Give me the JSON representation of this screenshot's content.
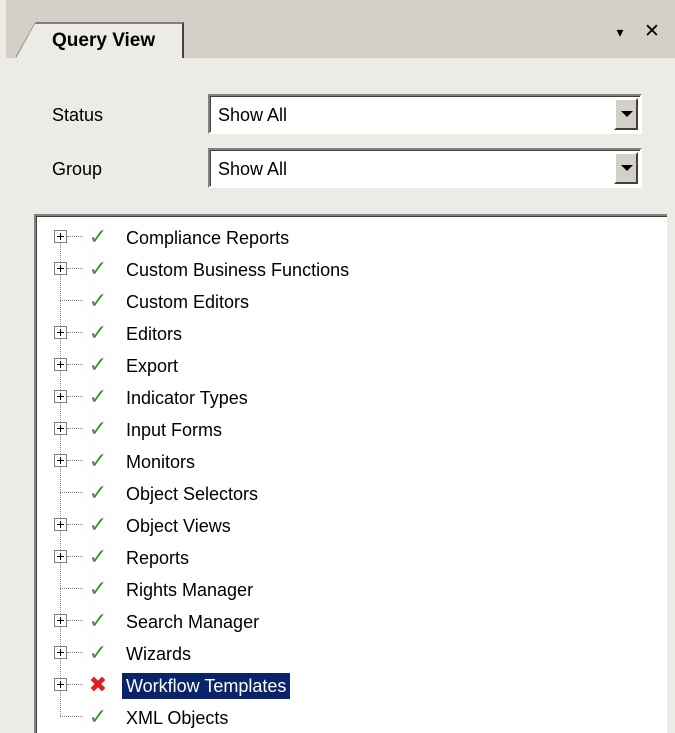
{
  "tab": {
    "title": "Query View"
  },
  "pane_buttons": {
    "dropdown": "▾",
    "close": "✕"
  },
  "filters": {
    "status": {
      "label": "Status",
      "value": "Show All"
    },
    "group": {
      "label": "Group",
      "value": "Show All"
    }
  },
  "tree": {
    "items": [
      {
        "label": "Compliance Reports",
        "expandable": true,
        "status": "ok"
      },
      {
        "label": "Custom Business Functions",
        "expandable": true,
        "status": "ok"
      },
      {
        "label": "Custom Editors",
        "expandable": false,
        "status": "ok"
      },
      {
        "label": "Editors",
        "expandable": true,
        "status": "ok"
      },
      {
        "label": "Export",
        "expandable": true,
        "status": "ok"
      },
      {
        "label": "Indicator Types",
        "expandable": true,
        "status": "ok"
      },
      {
        "label": "Input Forms",
        "expandable": true,
        "status": "ok"
      },
      {
        "label": "Monitors",
        "expandable": true,
        "status": "ok"
      },
      {
        "label": "Object Selectors",
        "expandable": false,
        "status": "ok"
      },
      {
        "label": "Object Views",
        "expandable": true,
        "status": "ok"
      },
      {
        "label": "Reports",
        "expandable": true,
        "status": "ok"
      },
      {
        "label": "Rights Manager",
        "expandable": false,
        "status": "ok"
      },
      {
        "label": "Search Manager",
        "expandable": true,
        "status": "ok"
      },
      {
        "label": "Wizards",
        "expandable": true,
        "status": "ok"
      },
      {
        "label": "Workflow Templates",
        "expandable": true,
        "status": "error",
        "selected": true
      },
      {
        "label": "XML Objects",
        "expandable": false,
        "status": "ok"
      }
    ]
  },
  "colors": {
    "ok_check": "#3a9a2a",
    "error_x": "#e02020",
    "selection": "#0a246a"
  }
}
